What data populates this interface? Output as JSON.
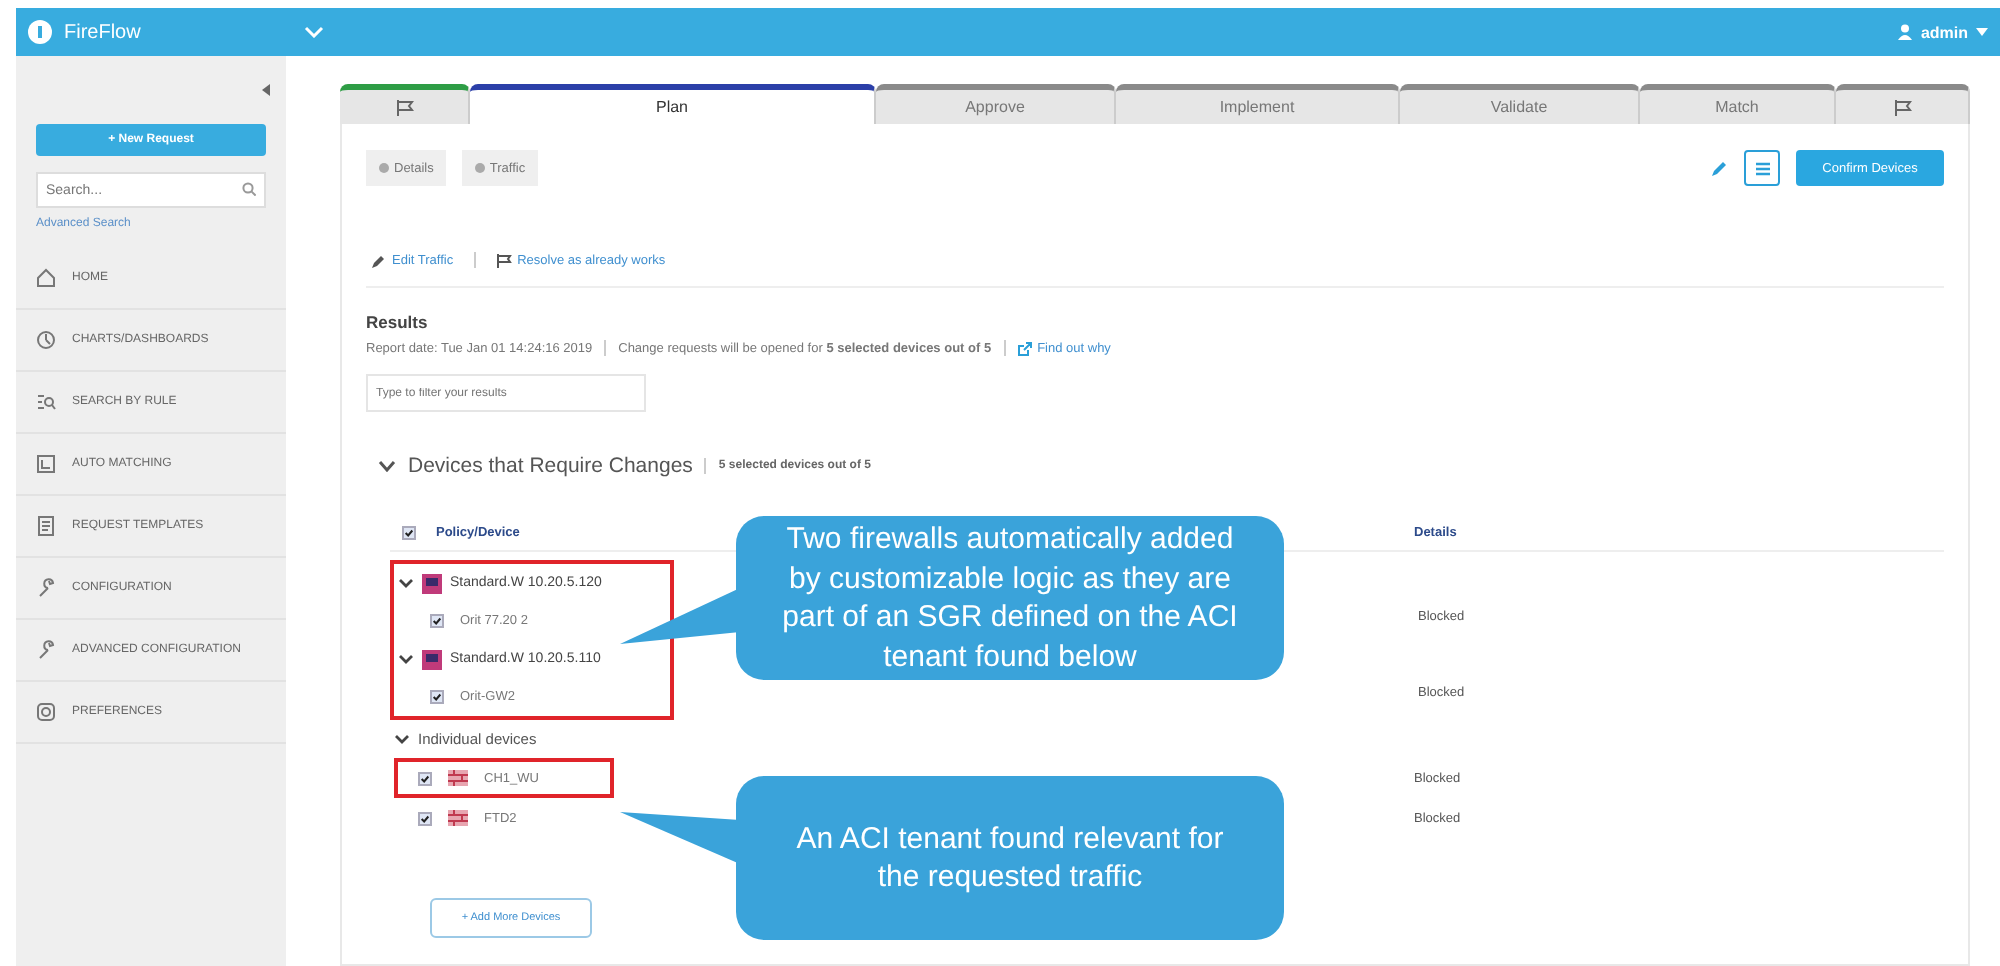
{
  "app": {
    "name": "FireFlow",
    "user": "admin"
  },
  "sidebar": {
    "new_button": "+ New Request",
    "search_placeholder": "Search...",
    "advanced_link": "Advanced Search",
    "items": [
      {
        "label": "HOME"
      },
      {
        "label": "CHARTS/DASHBOARDS"
      },
      {
        "label": "SEARCH BY RULE"
      },
      {
        "label": "AUTO MATCHING"
      },
      {
        "label": "REQUEST TEMPLATES"
      },
      {
        "label": "CONFIGURATION"
      },
      {
        "label": "ADVANCED CONFIGURATION"
      },
      {
        "label": "PREFERENCES"
      }
    ]
  },
  "tabs": [
    {
      "kind": "icon",
      "selected": false,
      "done": true
    },
    {
      "kind": "text",
      "label": "Plan",
      "selected": true,
      "done": false
    },
    {
      "kind": "text",
      "label": "Approve",
      "selected": false,
      "done": false
    },
    {
      "kind": "text",
      "label": "Implement",
      "selected": false,
      "done": false
    },
    {
      "kind": "text",
      "label": "Validate",
      "selected": false,
      "done": false
    },
    {
      "kind": "text",
      "label": "Match",
      "selected": false,
      "done": false
    },
    {
      "kind": "icon",
      "selected": false,
      "done": false
    }
  ],
  "toolbar": {
    "buttons": [
      "Details",
      "Traffic"
    ],
    "confirm": "Confirm Devices"
  },
  "actions": [
    {
      "label": "Edit Traffic"
    },
    {
      "label": "Resolve as already works"
    }
  ],
  "results": {
    "title": "Results",
    "report_date": "Report date: Tue Jan 01 14:24:16 2019",
    "change_note": "Change requests will be opened for **5 selected devices out of 5**",
    "link": "Find out why",
    "filter_placeholder": "Type to filter your results"
  },
  "devices": {
    "title": "Devices that Require Changes",
    "expanded": true,
    "summary": "5 selected devices out of 5",
    "header_checked": true,
    "columns": [
      "Policy/Device",
      "Details"
    ],
    "sections": [
      {
        "kind": "policies",
        "highlighted": true,
        "groups": [
          {
            "label": "Standard.W 10.20.5.120",
            "expanded": true,
            "children": [
              {
                "name": "Orit 77.20 2",
                "checked": true,
                "details": "Blocked"
              }
            ]
          },
          {
            "label": "Standard.W 10.20.5.110",
            "expanded": true,
            "children": [
              {
                "name": "Orit-GW2",
                "checked": true,
                "details": "Blocked"
              }
            ]
          }
        ]
      },
      {
        "kind": "individual",
        "label": "Individual devices",
        "expanded": true,
        "children": [
          {
            "name": "CH1_WU",
            "checked": true,
            "highlighted": true,
            "details": "Blocked"
          },
          {
            "name": "FTD2",
            "checked": true,
            "highlighted": false,
            "details": "Blocked"
          }
        ]
      }
    ],
    "add_button": "+ Add More Devices"
  },
  "callouts": [
    {
      "text": "Two firewalls automatically added by customizable logic as they are part of an SGR defined on the ACI tenant found below"
    },
    {
      "text": "An ACI tenant found relevant for the requested traffic"
    }
  ]
}
